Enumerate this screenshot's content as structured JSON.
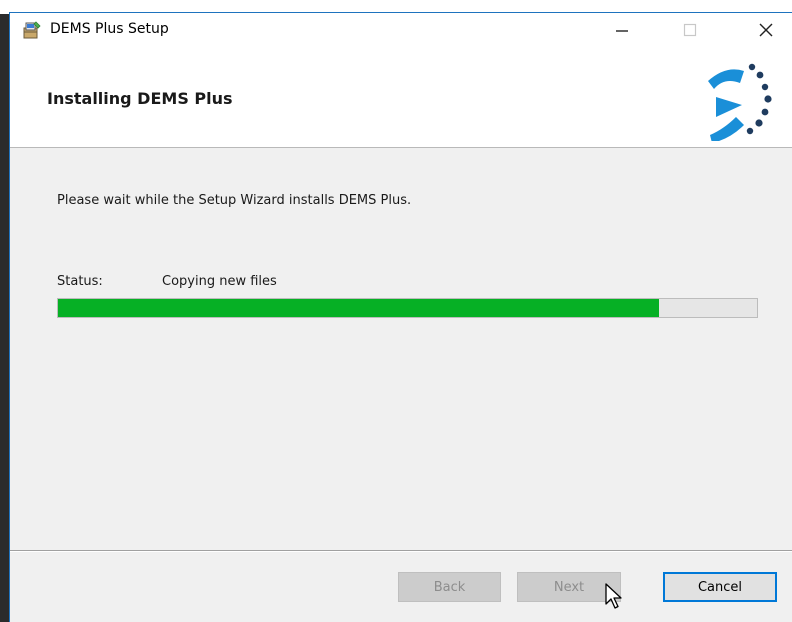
{
  "window": {
    "title": "DEMS Plus Setup",
    "controls": {
      "minimize_icon": "minimize-icon",
      "maximize_icon": "maximize-icon",
      "close_icon": "close-icon"
    }
  },
  "header": {
    "title": "Installing DEMS Plus",
    "logo": "brand-logo"
  },
  "body": {
    "message": "Please wait while the Setup Wizard installs DEMS Plus.",
    "status_label": "Status:",
    "status_value": "Copying new files",
    "progress_fraction": 0.86
  },
  "buttons": {
    "back": "Back",
    "next": "Next",
    "cancel": "Cancel"
  },
  "colors": {
    "progress_fill": "#06b025",
    "accent": "#0078d7",
    "logo_blue": "#1a8fd8",
    "logo_dark": "#1f3c5f"
  }
}
